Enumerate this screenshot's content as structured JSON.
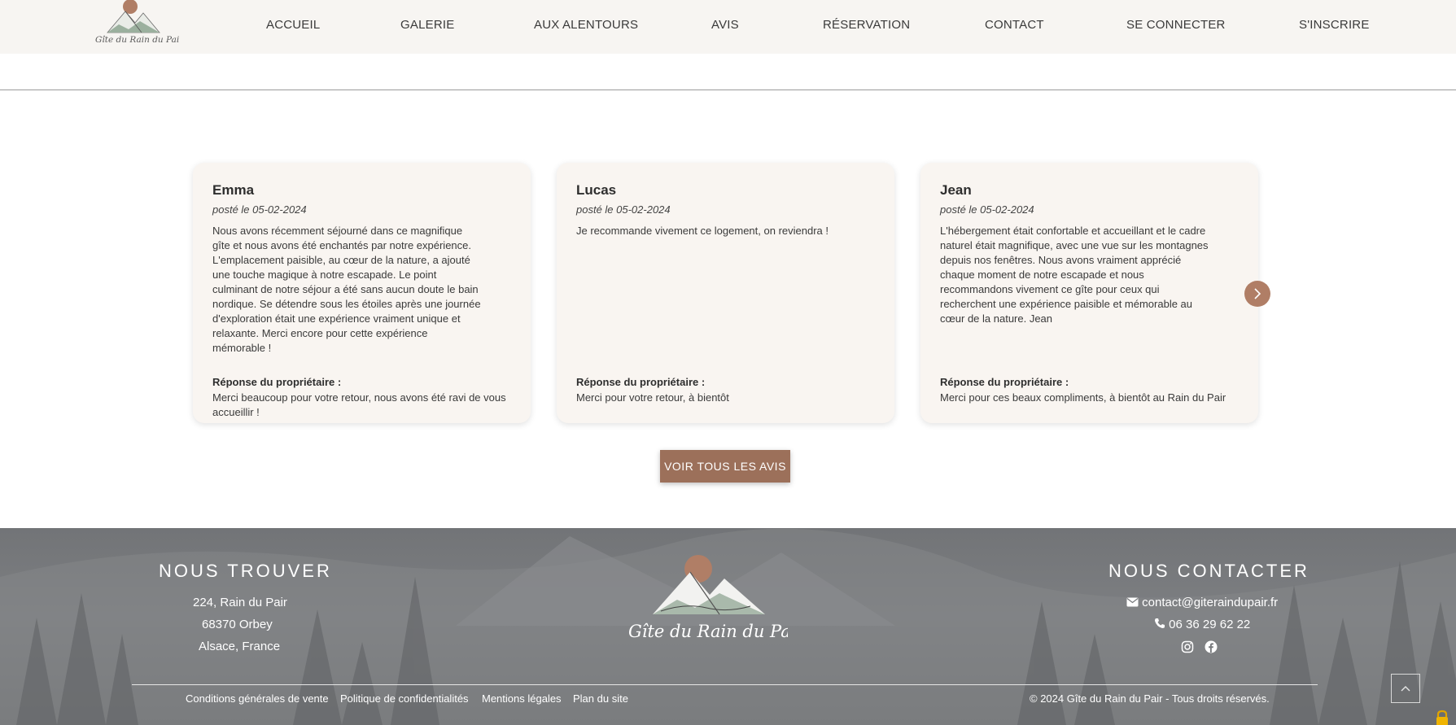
{
  "brand": {
    "logo_text": "Gîte du Rain du Pair"
  },
  "nav": {
    "items": [
      {
        "label": "ACCUEIL"
      },
      {
        "label": "GALERIE"
      },
      {
        "label": "AUX ALENTOURS"
      },
      {
        "label": "AVIS"
      },
      {
        "label": "RÉSERVATION"
      },
      {
        "label": "CONTACT"
      },
      {
        "label": "SE CONNECTER"
      },
      {
        "label": "S'INSCRIRE"
      }
    ]
  },
  "reviews": [
    {
      "name": "Emma",
      "date": "posté le 05-02-2024",
      "text": "Nous avons récemment séjourné dans ce magnifique gîte et nous avons été enchantés par notre expérience. L'emplacement paisible, au cœur de la nature, a ajouté une touche magique à notre escapade. Le point culminant de notre séjour a été sans aucun doute le bain nordique. Se détendre sous les étoiles après une journée d'exploration était une expérience vraiment unique et relaxante. Merci encore pour cette expérience mémorable !",
      "reply_title": "Réponse du propriétaire :",
      "reply": "Merci beaucoup pour votre retour, nous avons été ravi de vous accueillir !"
    },
    {
      "name": "Lucas",
      "date": "posté le 05-02-2024",
      "text": "Je recommande vivement ce logement, on reviendra !",
      "reply_title": "Réponse du propriétaire :",
      "reply": "Merci pour votre retour, à bientôt"
    },
    {
      "name": "Jean",
      "date": "posté le 05-02-2024",
      "text": "L'hébergement était confortable et accueillant et le cadre naturel était magnifique, avec une vue sur les montagnes depuis nos fenêtres. Nous avons vraiment apprécié chaque moment de notre escapade et nous recommandons vivement ce gîte pour ceux qui recherchent une expérience paisible et mémorable au cœur de la nature. Jean",
      "reply_title": "Réponse du propriétaire :",
      "reply": "Merci pour ces beaux compliments, à bientôt au Rain du Pair"
    }
  ],
  "cta": {
    "label": "VOIR TOUS LES AVIS"
  },
  "footer": {
    "find_us": {
      "heading": "NOUS TROUVER",
      "lines": [
        "224, Rain du Pair",
        "68370 Orbey",
        "Alsace, France"
      ]
    },
    "contact": {
      "heading": "NOUS CONTACTER",
      "email": "contact@giteraindupair.fr",
      "phone": "06 36 29 62 22"
    },
    "links": [
      {
        "label": "Conditions générales de vente"
      },
      {
        "label": "Politique de confidentialités"
      },
      {
        "label": "Mentions légales"
      },
      {
        "label": "Plan du site"
      }
    ],
    "copyright": "© 2024 Gîte du Rain du Pair - Tous droits réservés."
  },
  "colors": {
    "accent": "#9c705a",
    "nav_bg": "#f7f5f2",
    "card_bg": "#f9f5f1",
    "footer_bg": "#76787b"
  },
  "icons": [
    "logo-mountain-icon",
    "chevron-right-icon",
    "envelope-icon",
    "phone-icon",
    "instagram-icon",
    "facebook-icon",
    "chevron-up-icon",
    "lock-icon"
  ]
}
